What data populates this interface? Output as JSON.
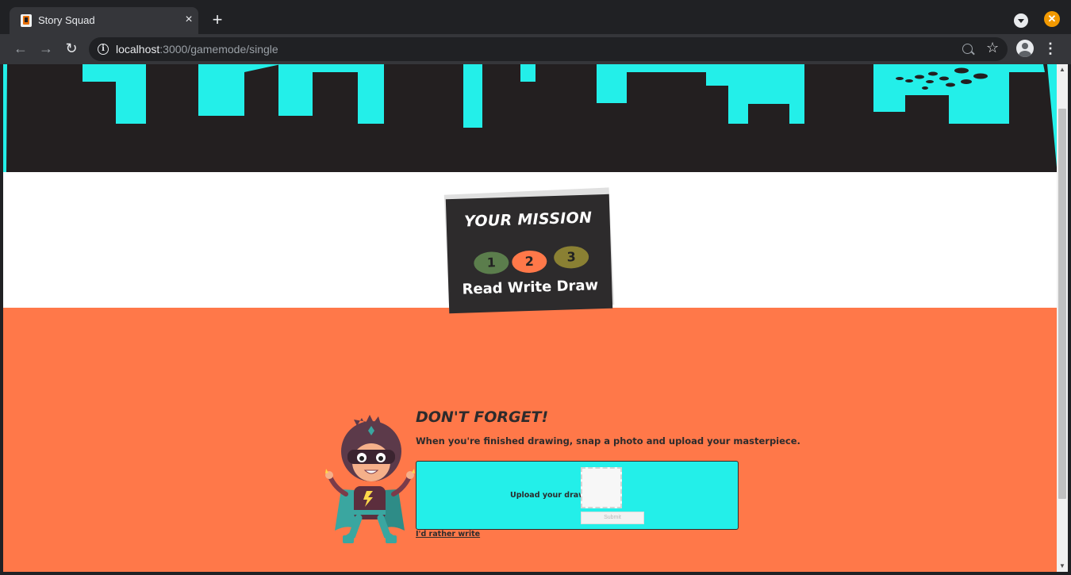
{
  "browser": {
    "tab_title": "Story Squad",
    "tab_close_icon": "×",
    "new_tab_icon": "+",
    "url_host": "localhost",
    "url_path": ":3000/gamemode/single",
    "window_close_icon": "✕",
    "menu_icon": "⋮",
    "star_icon": "☆",
    "back_icon": "←",
    "forward_icon": "→",
    "reload_icon": "↻",
    "info_icon": "i"
  },
  "mission": {
    "title": "YOUR MISSION",
    "steps": [
      "1",
      "2",
      "3"
    ],
    "step_labels": "Read Write Draw"
  },
  "upload": {
    "heading": "DON'T FORGET!",
    "instructions": "When you're finished drawing, snap a photo and upload your masterpiece.",
    "label": "Upload your drawing",
    "submit_label": "Submit",
    "alt_link": "I'd rather write"
  },
  "colors": {
    "skyline": "#23efe9",
    "dark": "#231f20",
    "orange": "#ff7849",
    "step1": "#5b7d4c",
    "step2": "#ff7849",
    "step3": "#8a8033"
  },
  "scrollbar": {
    "up_icon": "▲",
    "down_icon": "▼"
  }
}
